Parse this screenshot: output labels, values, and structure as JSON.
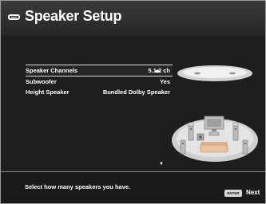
{
  "header": {
    "title": "Speaker Setup",
    "icon": "speaker-setup-icon"
  },
  "settings": [
    {
      "label": "Speaker Channels",
      "value": "5.1.2 ch",
      "selected": true
    },
    {
      "label": "Subwoofer",
      "value": "Yes",
      "selected": false
    },
    {
      "label": "Height Speaker",
      "value": "Bundled Dolby Speaker",
      "selected": false
    }
  ],
  "footer": {
    "hint": "Select how many speakers you have.",
    "enter_key": "ENTER",
    "next_label": "Next"
  },
  "colors": {
    "background": "#1e1e1e",
    "text": "#ffffff",
    "selection_border": "#dcdcdc",
    "illustration": "#d9d9d9"
  }
}
